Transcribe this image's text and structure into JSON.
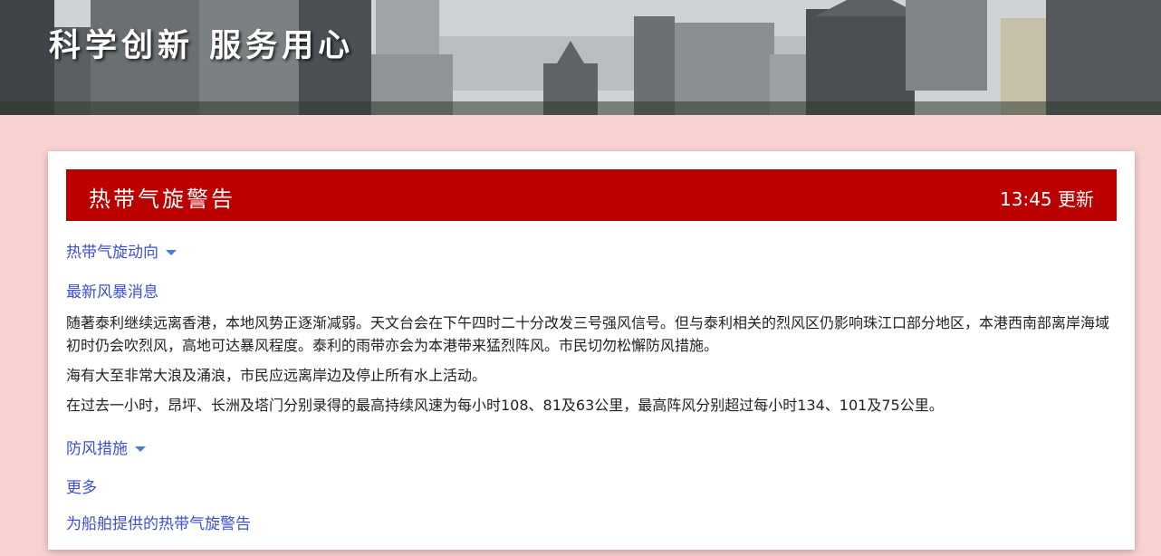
{
  "banner": {
    "slogan": "科学创新 服务用心"
  },
  "warning": {
    "title": "热带气旋警告",
    "update_time": "13:45 更新"
  },
  "links": {
    "movement": "热带气旋动向",
    "latest_news": "最新风暴消息",
    "precautions": "防风措施",
    "more": "更多",
    "ships": "为船舶提供的热带气旋警告"
  },
  "paragraphs": [
    "随著泰利继续远离香港，本地风势正逐渐减弱。天文台会在下午四时二十分改发三号强风信号。但与泰利相关的烈风区仍影响珠江口部分地区，本港西南部离岸海域初时仍会吹烈风，高地可达暴风程度。泰利的雨带亦会为本港带来猛烈阵风。市民切勿松懈防风措施。",
    "海有大至非常大浪及涌浪，市民应远离岸边及停止所有水上活动。",
    "在过去一小时，昂坪、长洲及塔门分别录得的最高持续风速为每小时108、81及63公里，最高阵风分别超过每小时134、101及75公里。"
  ],
  "colors": {
    "title_bar": "#bc0000",
    "link": "#3a4fd4",
    "page_bg": "#f9d1d1"
  }
}
